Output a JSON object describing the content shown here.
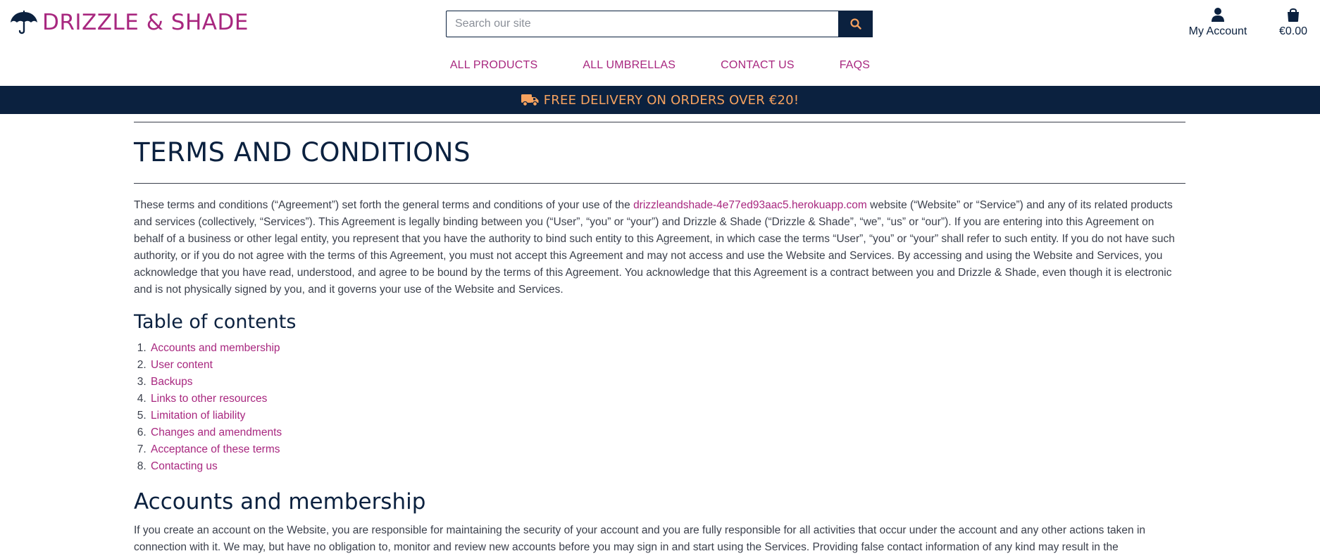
{
  "brand": {
    "name": "DRIZZLE & SHADE",
    "color": "#a8277f",
    "logo_icon": "umbrella-icon"
  },
  "search": {
    "placeholder": "Search our site",
    "value": "",
    "icon": "search-icon"
  },
  "account": {
    "label": "My Account",
    "icon": "user-icon"
  },
  "cart": {
    "total": "€0.00",
    "icon": "shopping-bag-icon"
  },
  "nav": {
    "items": [
      {
        "label": "ALL PRODUCTS"
      },
      {
        "label": "ALL UMBRELLAS"
      },
      {
        "label": "CONTACT US"
      },
      {
        "label": "FAQS"
      }
    ]
  },
  "banner": {
    "text": "FREE DELIVERY ON ORDERS OVER €20!",
    "icon": "truck-icon",
    "bg": "#0b213f",
    "color": "#f6a25f"
  },
  "page": {
    "title": "TERMS AND CONDITIONS",
    "intro_before_link": "These terms and conditions (“Agreement”) set forth the general terms and conditions of your use of the ",
    "intro_link": "drizzleandshade-4e77ed93aac5.herokuapp.com",
    "intro_after_link": " website (“Website” or “Service”) and any of its related products and services (collectively, “Services”). This Agreement is legally binding between you (“User”, “you” or “your”) and Drizzle & Shade (“Drizzle & Shade”, “we”, “us” or “our”). If you are entering into this Agreement on behalf of a business or other legal entity, you represent that you have the authority to bind such entity to this Agreement, in which case the terms “User”, “you” or “your” shall refer to such entity. If you do not have such authority, or if you do not agree with the terms of this Agreement, you must not accept this Agreement and may not access and use the Website and Services. By accessing and using the Website and Services, you acknowledge that you have read, understood, and agree to be bound by the terms of this Agreement. You acknowledge that this Agreement is a contract between you and Drizzle & Shade, even though it is electronic and is not physically signed by you, and it governs your use of the Website and Services.",
    "toc_heading": "Table of contents",
    "toc": [
      "Accounts and membership",
      "User content",
      "Backups",
      "Links to other resources",
      "Limitation of liability",
      "Changes and amendments",
      "Acceptance of these terms",
      "Contacting us"
    ],
    "section1_heading": "Accounts and membership",
    "section1_text": "If you create an account on the Website, you are responsible for maintaining the security of your account and you are fully responsible for all activities that occur under the account and any other actions taken in connection with it. We may, but have no obligation to, monitor and review new accounts before you may sign in and start using the Services. Providing false contact information of any kind may result in the"
  },
  "colors": {
    "navy": "#0b213f",
    "accent": "#a8277f",
    "orange": "#f6a25f",
    "text": "#3a3f4b"
  }
}
